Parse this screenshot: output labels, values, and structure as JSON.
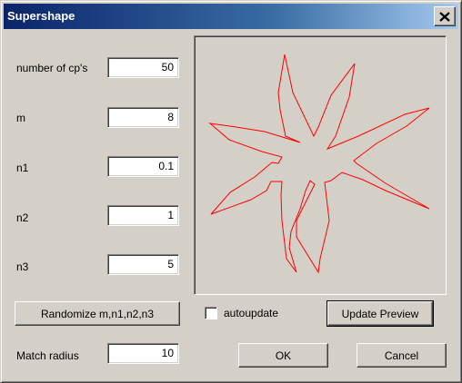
{
  "window": {
    "title": "Supershape"
  },
  "params": [
    {
      "key": "cps",
      "label": "number of cp's",
      "value": "50"
    },
    {
      "key": "m",
      "label": "m",
      "value": "8"
    },
    {
      "key": "n1",
      "label": "n1",
      "value": "0.1"
    },
    {
      "key": "n2",
      "label": "n2",
      "value": "1"
    },
    {
      "key": "n3",
      "label": "n3",
      "value": "5"
    }
  ],
  "buttons": {
    "randomize": "Randomize m,n1,n2,n3",
    "update_preview": "Update Preview",
    "ok": "OK",
    "cancel": "Cancel"
  },
  "autoupdate": {
    "label": "autoupdate",
    "checked": false
  },
  "match_radius": {
    "label": "Match radius",
    "value": "10"
  },
  "preview": {
    "shape": "supershape-curve",
    "stroke_color": "#ff0000",
    "points": 8
  }
}
